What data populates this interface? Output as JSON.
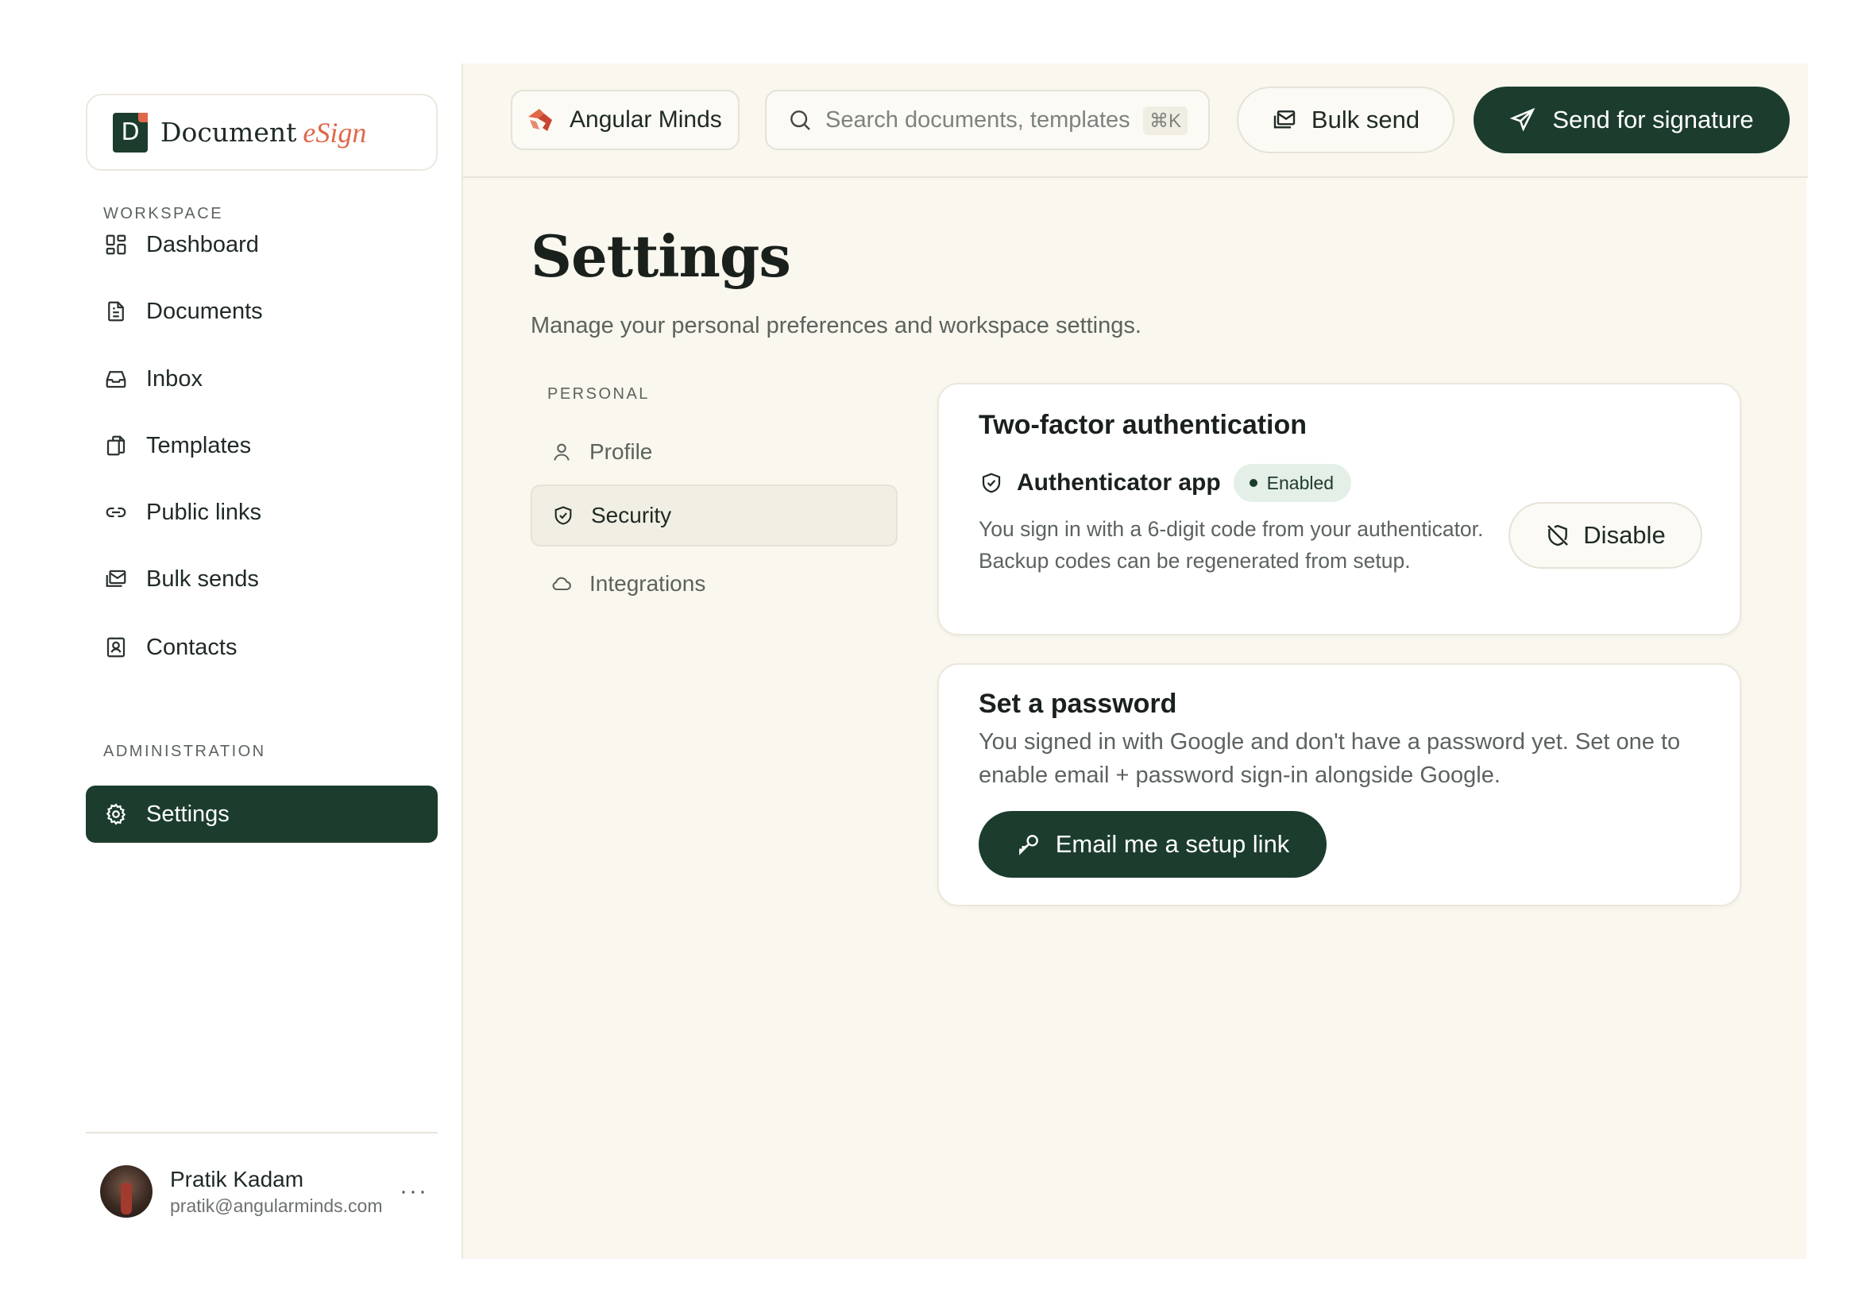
{
  "brand": {
    "initial": "D",
    "name": "Document",
    "accent": "eSign"
  },
  "sidebar": {
    "workspace_label": "WORKSPACE",
    "admin_label": "ADMINISTRATION",
    "items": [
      {
        "label": "Dashboard",
        "icon": "dashboard-icon"
      },
      {
        "label": "Documents",
        "icon": "document-icon"
      },
      {
        "label": "Inbox",
        "icon": "inbox-icon"
      },
      {
        "label": "Templates",
        "icon": "templates-icon"
      },
      {
        "label": "Public links",
        "icon": "link-icon"
      },
      {
        "label": "Bulk sends",
        "icon": "bulk-send-icon"
      },
      {
        "label": "Contacts",
        "icon": "contacts-icon"
      }
    ],
    "admin_items": [
      {
        "label": "Settings",
        "icon": "gear-icon",
        "active": true
      }
    ]
  },
  "user": {
    "name": "Pratik Kadam",
    "email": "pratik@angularminds.com",
    "more": "···"
  },
  "topbar": {
    "org_name": "Angular Minds",
    "search_placeholder": "Search documents, templates",
    "search_shortcut": "⌘K",
    "bulk_send_label": "Bulk send",
    "send_label": "Send for signature"
  },
  "page": {
    "title": "Settings",
    "subtitle": "Manage your personal preferences and workspace settings."
  },
  "subnav": {
    "section_label": "PERSONAL",
    "items": [
      {
        "label": "Profile",
        "icon": "user-icon"
      },
      {
        "label": "Security",
        "icon": "shield-icon",
        "active": true
      },
      {
        "label": "Integrations",
        "icon": "cloud-icon"
      }
    ]
  },
  "two_factor": {
    "title": "Two-factor authentication",
    "method": "Authenticator app",
    "status": "Enabled",
    "description": "You sign in with a 6-digit code from your authenticator. Backup codes can be regenerated from setup.",
    "disable_label": "Disable"
  },
  "password": {
    "title": "Set a password",
    "description": "You signed in with Google and don't have a password yet. Set one to enable email + password sign-in alongside Google.",
    "setup_label": "Email me a setup link"
  },
  "colors": {
    "primary": "#1c3d2e",
    "accent": "#e0674a",
    "background": "#f9f7ee",
    "badge_bg": "#e4efe8"
  }
}
